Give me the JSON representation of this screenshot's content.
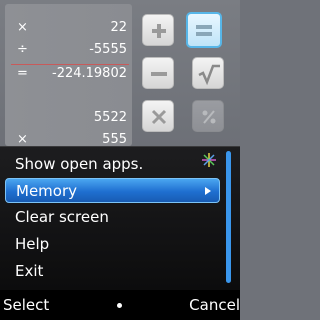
{
  "calculator": {
    "tape": [
      {
        "op": "×",
        "value": "22"
      },
      {
        "op": "÷",
        "value": "-5555"
      },
      {
        "op": "=",
        "value": "-224.19802"
      },
      {
        "op": "",
        "value": ""
      },
      {
        "op": "",
        "value": "5522"
      },
      {
        "op": "×",
        "value": "555"
      }
    ],
    "keys": [
      {
        "name": "plus",
        "label": "+"
      },
      {
        "name": "equals",
        "label": "="
      },
      {
        "name": "minus",
        "label": "−"
      },
      {
        "name": "sqrt",
        "label": "√"
      },
      {
        "name": "multiply",
        "label": "×"
      },
      {
        "name": "percent",
        "label": "%"
      }
    ]
  },
  "menu": {
    "items": [
      {
        "label": "Show open apps."
      },
      {
        "label": "Memory",
        "selected": true,
        "has_submenu": true
      },
      {
        "label": "Clear screen"
      },
      {
        "label": "Help"
      },
      {
        "label": "Exit"
      }
    ],
    "icons": {
      "open_apps": "star-icon",
      "submenu": "arrow-right-icon"
    },
    "accent_color": "#1f6fd0"
  },
  "softkeys": {
    "left": "Select",
    "right": "Cancel"
  }
}
